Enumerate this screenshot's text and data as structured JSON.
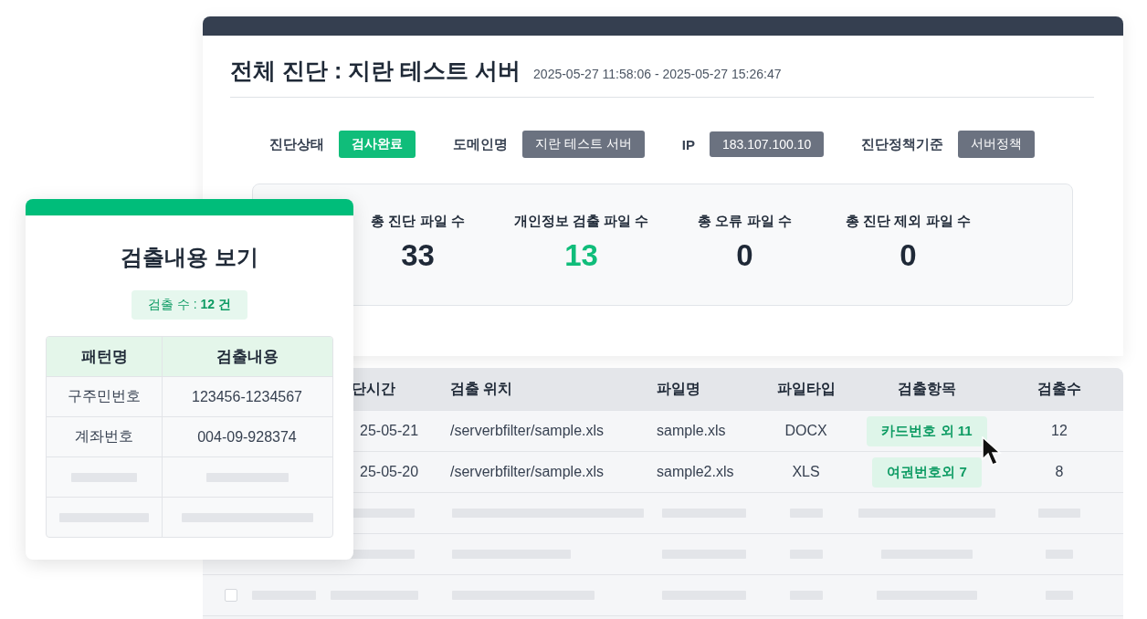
{
  "report": {
    "title": "전체 진단 : 지란 테스트 서버",
    "period": "2025-05-27 11:58:06 - 2025-05-27 15:26:47",
    "info": [
      {
        "label": "진단상태",
        "value": "검사완료",
        "kind": "status"
      },
      {
        "label": "도메인명",
        "value": "지란 테스트 서버",
        "kind": "tag"
      },
      {
        "label": "IP",
        "value": "183.107.100.10",
        "kind": "tag"
      },
      {
        "label": "진단정책기준",
        "value": "서버정책",
        "kind": "tag"
      }
    ],
    "stats": [
      {
        "label": "총 진단 파일 수",
        "value": "33",
        "highlight": false
      },
      {
        "label": "개인정보 검출 파일 수",
        "value": "13",
        "highlight": true
      },
      {
        "label": "총 오류 파일 수",
        "value": "0",
        "highlight": false
      },
      {
        "label": "총 진단 제외 파일 수",
        "value": "0",
        "highlight": false
      }
    ]
  },
  "table": {
    "columns": [
      "단시간",
      "검출 위치",
      "파일명",
      "파일타입",
      "검출항목",
      "검출수"
    ],
    "row_checkbox": {
      "checked": false
    },
    "rows": [
      {
        "cells": [
          "25-05-21",
          "/serverbfilter/sample.xls",
          "sample.xls",
          "DOCX",
          "카드번호 외 11",
          "12"
        ]
      },
      {
        "cells": [
          "25-05-20",
          "/serverbfilter/sample.xls",
          "sample2.xls",
          "XLS",
          "여권번호외 7",
          "8"
        ]
      }
    ]
  },
  "detail_card": {
    "title": "검출내용 보기",
    "count": "검출 수 : **12 건**",
    "columns": [
      "패턴명",
      "검출내용"
    ],
    "rows": [
      {
        "cells": [
          "구주민번호",
          "123456-1234567"
        ]
      },
      {
        "cells": [
          "계좌번호",
          "004-09-928374"
        ]
      }
    ]
  }
}
